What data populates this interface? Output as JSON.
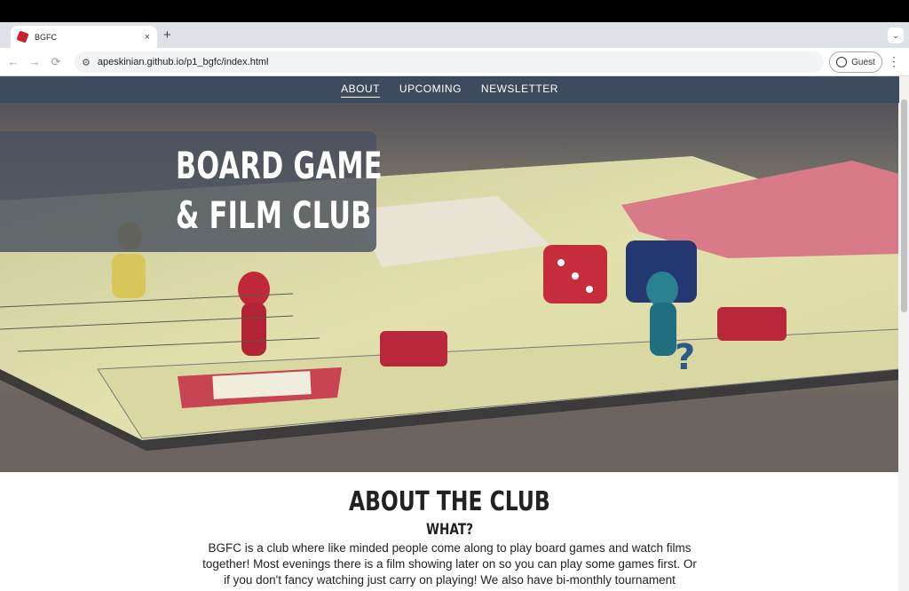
{
  "browser": {
    "tab_title": "BGFC",
    "tab_close": "×",
    "new_tab": "+",
    "tab_menu": "⌄",
    "back": "←",
    "forward": "→",
    "reload": "⟳",
    "url": "apeskinian.github.io/p1_bgfc/index.html",
    "profile_label": "Guest",
    "menu": "⋮"
  },
  "site": {
    "nav": [
      {
        "label": "ABOUT",
        "active": true
      },
      {
        "label": "UPCOMING",
        "active": false
      },
      {
        "label": "NEWSLETTER",
        "active": false
      }
    ],
    "hero": {
      "title_line1": "BOARD GAME",
      "title_line2": "& FILM CLUB"
    },
    "about": {
      "heading": "ABOUT THE CLUB",
      "subheading": "WHAT?",
      "paragraph": "BGFC is a club where like minded people come along to play board games and watch films together! Most evenings there is a film showing later on so you can play some games first. Or if you don't fancy watching just carry on playing! We also have bi-monthly tournament"
    }
  },
  "colors": {
    "nav_bg": "#3e4a5e",
    "title_box_bg": "#4b505f",
    "board": "#e7e6b0"
  },
  "icons": [
    "favicon-die-icon",
    "close-icon",
    "plus-icon",
    "chevron-down-icon",
    "back-arrow-icon",
    "forward-arrow-icon",
    "reload-icon",
    "site-settings-icon",
    "person-icon",
    "kebab-menu-icon"
  ]
}
